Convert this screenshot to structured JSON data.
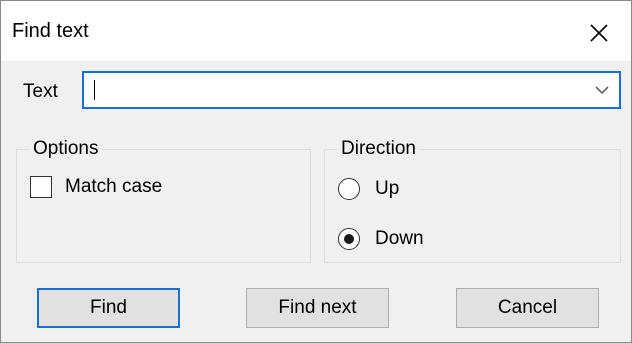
{
  "window": {
    "title": "Find text"
  },
  "icons": {
    "close": "close-icon",
    "dropdown": "chevron-down-icon"
  },
  "text_field": {
    "label": "Text",
    "value": ""
  },
  "options": {
    "legend": "Options",
    "match_case": {
      "label": "Match case",
      "checked": false
    }
  },
  "direction": {
    "legend": "Direction",
    "choices": [
      {
        "label": "Up",
        "selected": false
      },
      {
        "label": "Down",
        "selected": true
      }
    ]
  },
  "buttons": {
    "find": "Find",
    "find_next": "Find next",
    "cancel": "Cancel"
  },
  "colors": {
    "accent": "#1a6fd0",
    "dialog_bg": "#f0f0f0",
    "button_bg": "#e1e1e1"
  }
}
